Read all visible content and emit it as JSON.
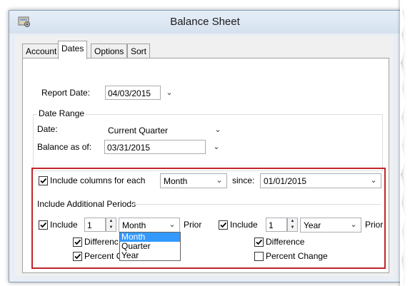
{
  "window": {
    "title": "Balance Sheet",
    "icon": "balance-sheet-app-icon"
  },
  "tabs": [
    {
      "label": "Account",
      "active": false
    },
    {
      "label": "Dates",
      "active": true
    },
    {
      "label": "Options",
      "active": false
    },
    {
      "label": "Sort",
      "active": false
    }
  ],
  "report_date": {
    "label": "Report Date:",
    "value": "04/03/2015"
  },
  "date_range": {
    "title": "Date Range",
    "date_label": "Date:",
    "date_value": "Current Quarter",
    "balance_label": "Balance as of:",
    "balance_value": "03/31/2015"
  },
  "include_columns": {
    "checked": true,
    "label": "Include columns for each",
    "period": "Month",
    "since_label": "since:",
    "since_value": "01/01/2015"
  },
  "additional": {
    "title": "Include Additional Periods",
    "left": {
      "include_checked": true,
      "include_label": "Include",
      "count": "1",
      "period": "Month",
      "prior_label": "Prior",
      "difference_checked": true,
      "difference_label": "Differenc",
      "percent_checked": true,
      "percent_label": "Percent C"
    },
    "right": {
      "include_checked": true,
      "include_label": "Include",
      "count": "1",
      "period": "Year",
      "prior_label": "Prior",
      "difference_checked": true,
      "difference_label": "Difference",
      "percent_checked": false,
      "percent_label": "Percent Change"
    }
  },
  "dropdown_options": [
    "Month",
    "Quarter",
    "Year"
  ],
  "dropdown_selected": "Month",
  "colors": {
    "highlight_box": "#c0262c",
    "selection": "#3399ff"
  }
}
